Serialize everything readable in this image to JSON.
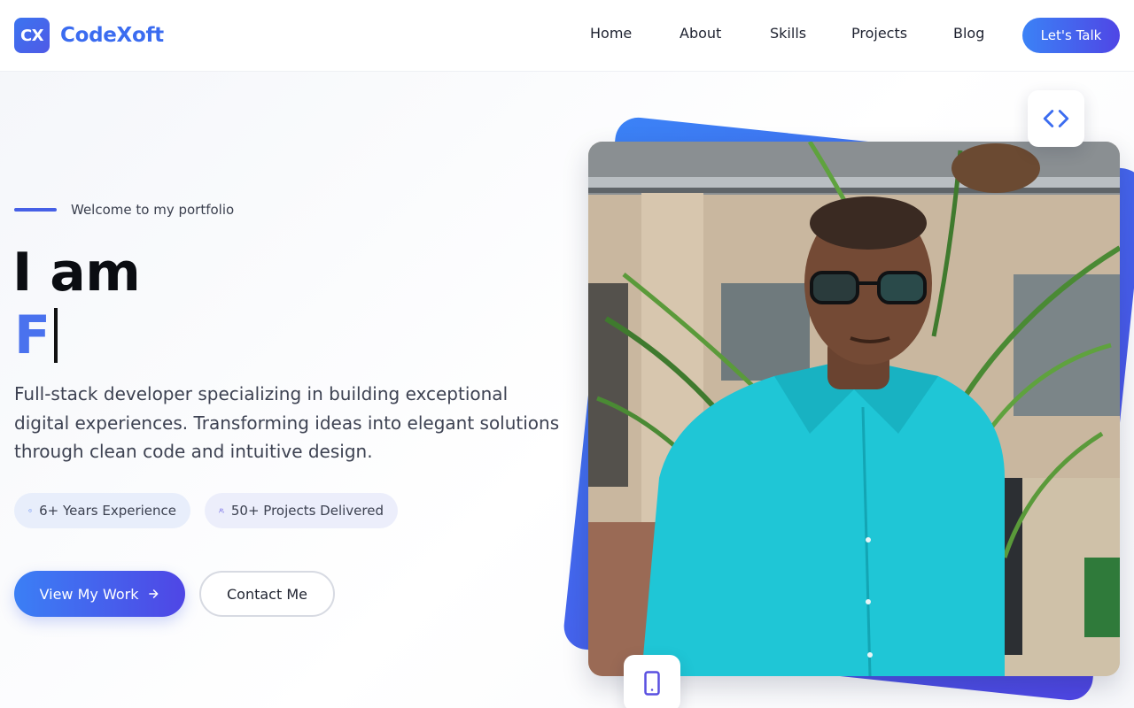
{
  "brand": {
    "logo_initials": "CX",
    "name": "CodeXoft"
  },
  "nav": {
    "items": [
      {
        "label": "Home"
      },
      {
        "label": "About"
      },
      {
        "label": "Skills"
      },
      {
        "label": "Projects"
      },
      {
        "label": "Blog"
      }
    ],
    "cta_label": "Let's Talk"
  },
  "hero": {
    "eyebrow": "Welcome to my portfolio",
    "title": "I am",
    "typed_text": "F",
    "description": "Full-stack developer specializing in building exceptional digital experiences. Transforming ideas into elegant solutions through clean code and intuitive design.",
    "stats": [
      {
        "icon": "check-circle-icon",
        "label": "6+ Years Experience"
      },
      {
        "icon": "users-icon",
        "label": "50+ Projects Delivered"
      }
    ],
    "primary_button": "View My Work",
    "secondary_button": "Contact Me"
  },
  "showcase": {
    "photo": "portrait-photo",
    "badges": [
      "code-icon",
      "mobile-device-icon"
    ]
  },
  "colors": {
    "accent": "#4a6cf0",
    "accent_gradient_start": "#3b82f6",
    "accent_gradient_end": "#4f46e5",
    "stat_background": "#e8eefb"
  }
}
